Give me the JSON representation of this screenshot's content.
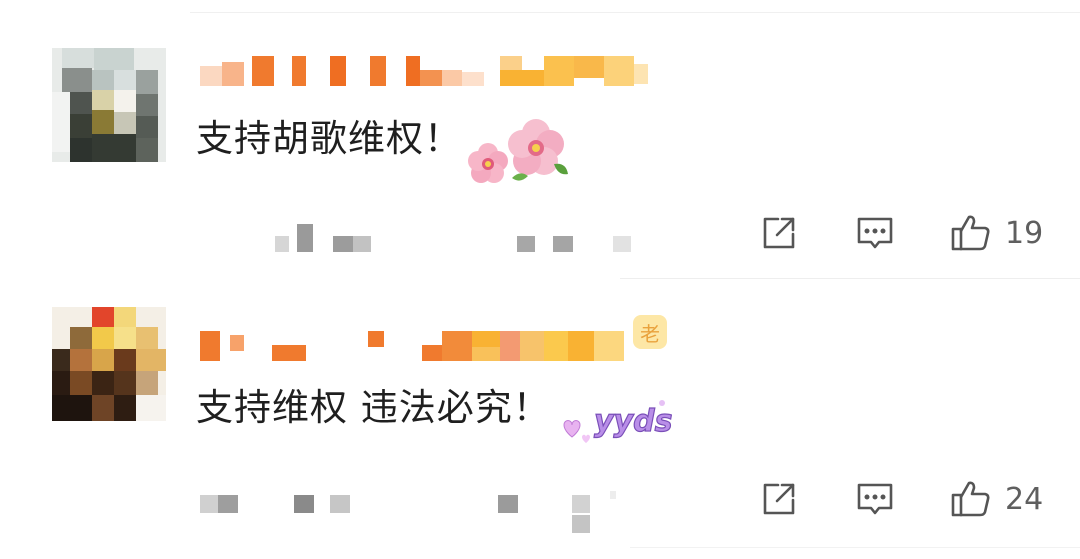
{
  "comments": [
    {
      "text": "支持胡歌维权！",
      "likes": "19",
      "sticker_icon": "peach-blossom-icon",
      "username_blurred": true
    },
    {
      "text": "支持维权 违法必究！",
      "likes": "24",
      "sticker_icon": "yyds-sticker-icon",
      "sticker_text": "yyds",
      "badge": "老",
      "username_blurred": true
    }
  ],
  "icons": {
    "share": "share-icon",
    "reply": "comment-icon",
    "like": "thumbs-up-icon"
  },
  "colors": {
    "username_orange": "#f07a2e",
    "username_light": "#fbc9a6",
    "username_yellow": "#f9b233",
    "text": "#1f1f1f",
    "icon": "#555555"
  }
}
